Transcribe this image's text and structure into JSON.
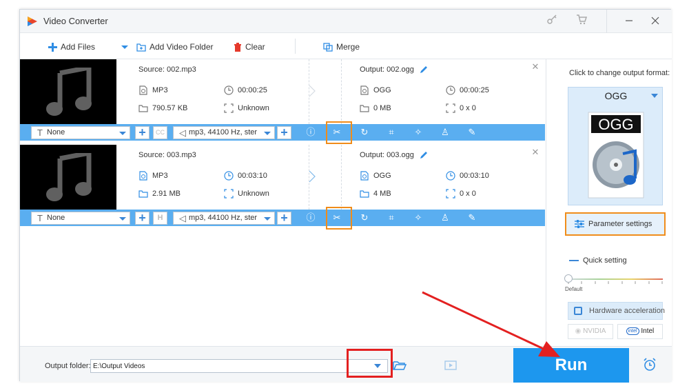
{
  "app": {
    "title": "Video Converter",
    "icons": [
      "key-icon",
      "cart-icon",
      "minimize-icon",
      "close-icon"
    ]
  },
  "toolbar": {
    "add_files": "Add Files",
    "add_folder": "Add Video Folder",
    "clear": "Clear",
    "merge": "Merge"
  },
  "files": [
    {
      "source": "Source: 002.mp3",
      "src_format": "MP3",
      "src_duration": "00:00:25",
      "src_size": "790.57 KB",
      "src_resolution": "Unknown",
      "output": "Output: 002.ogg",
      "out_format": "OGG",
      "out_duration": "00:00:25",
      "out_size": "0 MB",
      "out_resolution": "0 x 0",
      "subtitle": "None",
      "subtitle_icon": "cc-icon",
      "audio": "mp3, 44100 Hz, ster"
    },
    {
      "source": "Source: 003.mp3",
      "src_format": "MP3",
      "src_duration": "00:03:10",
      "src_size": "2.91 MB",
      "src_resolution": "Unknown",
      "output": "Output: 003.ogg",
      "out_format": "OGG",
      "out_duration": "00:03:10",
      "out_size": "4 MB",
      "out_resolution": "0 x 0",
      "subtitle": "None",
      "subtitle_icon": "h-icon",
      "audio": "mp3, 44100 Hz, ster"
    }
  ],
  "right_panel": {
    "label": "Click to change output format:",
    "format": "OGG",
    "param_settings": "Parameter settings",
    "quick_setting": "Quick setting",
    "slider_default": "Default",
    "hw_accel": "Hardware acceleration",
    "nvidia": "NVIDIA",
    "intel": "Intel"
  },
  "bottom": {
    "output_folder_label": "Output folder:",
    "output_folder_value": "E:\\Output Videos",
    "run": "Run"
  },
  "colors": {
    "accent": "#1d97ee",
    "edit_bar": "#5aaef0",
    "highlight": "#f08c1a",
    "annotation": "#e32020"
  }
}
